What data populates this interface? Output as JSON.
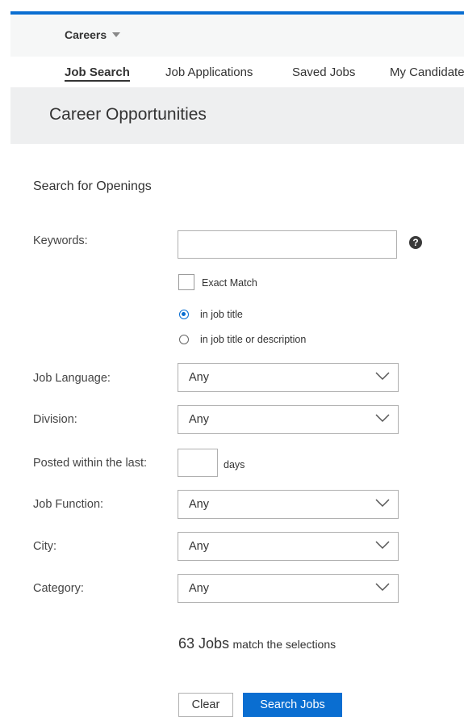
{
  "header": {
    "careers_menu": "Careers",
    "page_title": "Career Opportunities"
  },
  "nav": {
    "tabs": [
      {
        "label": "Job Search",
        "active": true
      },
      {
        "label": "Job Applications",
        "active": false
      },
      {
        "label": "Saved Jobs",
        "active": false
      },
      {
        "label": "My Candidate Profile",
        "active": false
      }
    ]
  },
  "search": {
    "section_title": "Search for Openings",
    "keywords_label": "Keywords:",
    "keywords_value": "",
    "help_glyph": "?",
    "exact_match_label": "Exact Match",
    "exact_match_checked": false,
    "scope_options": [
      {
        "label": "in job title",
        "selected": true
      },
      {
        "label": "in job title or description",
        "selected": false
      }
    ],
    "job_language_label": "Job Language:",
    "job_language_value": "Any",
    "division_label": "Division:",
    "division_value": "Any",
    "posted_label": "Posted within the last:",
    "posted_value": "",
    "posted_unit": "days",
    "job_function_label": "Job Function:",
    "job_function_value": "Any",
    "city_label": "City:",
    "city_value": "Any",
    "category_label": "Category:",
    "category_value": "Any"
  },
  "results": {
    "count_text": "63 Jobs",
    "suffix_text": "match the selections"
  },
  "buttons": {
    "clear": "Clear",
    "search": "Search Jobs"
  },
  "colors": {
    "accent": "#0a6ed1",
    "header_band": "#eeeff0"
  },
  "icons": {
    "help": "help-icon",
    "dropdown": "chevron-down-icon",
    "menu_caret": "caret-down-icon"
  }
}
